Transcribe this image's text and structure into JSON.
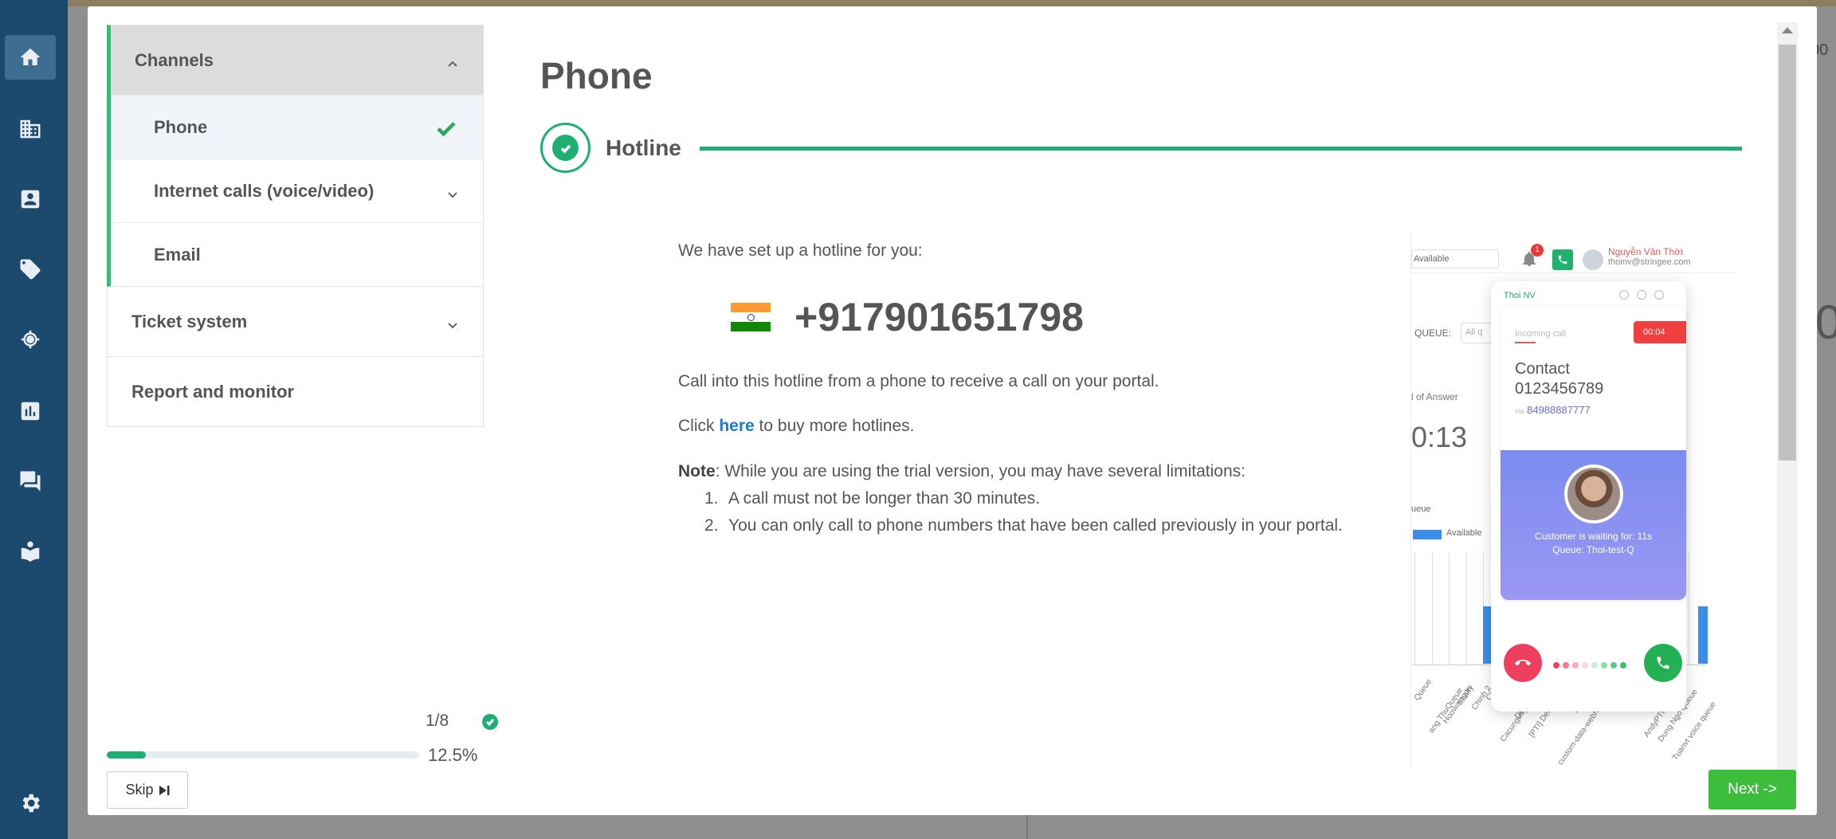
{
  "background": {
    "right_text_top": "00",
    "right_text_big": "0"
  },
  "leftnav": {
    "items": [
      "home-icon",
      "building-icon",
      "contact-card-icon",
      "tag-icon",
      "target-icon",
      "chart-icon",
      "chat-icon",
      "reader-icon"
    ],
    "bottom": "gear-icon"
  },
  "sidebar": {
    "sections": [
      {
        "label": "Channels",
        "expanded": true,
        "items": [
          {
            "label": "Phone",
            "current": true,
            "done": true
          },
          {
            "label": "Internet calls (voice/video)",
            "expandable": true
          },
          {
            "label": "Email"
          }
        ]
      },
      {
        "label": "Ticket system",
        "expandable": true
      },
      {
        "label": "Report and monitor"
      }
    ],
    "progress": {
      "step": "1/8",
      "percent_label": "12.5%",
      "fraction": 0.125
    },
    "skip_label": "Skip"
  },
  "main": {
    "title": "Phone",
    "step_label": "Hotline",
    "setup_text": "We have set up a hotline for you:",
    "hotline_number": "+917901651798",
    "call_text": "Call into this hotline from a phone to receive a call on your portal.",
    "click_prefix": "Click",
    "click_link": "here",
    "click_suffix": "to buy more hotlines.",
    "note_label": "Note",
    "note_text": ": While you are using the trial version, you may have several limitations:",
    "limits": [
      "A call must not be longer than 30 minutes.",
      "You can only call to phone numbers that have been called previously in your portal."
    ]
  },
  "illustration": {
    "status": "Available",
    "badge": "1",
    "user_name": "Nguyễn Văn Thời",
    "user_email": "thoinv@stringee.com",
    "queue_label": "QUEUE:",
    "queue_value": "All q",
    "answer_label": "l of Answer",
    "time": "0:13",
    "sueue_label": "ueue",
    "legend": "Available",
    "card_name": "Thoi NV",
    "incoming": "Incoming call",
    "timer": "00:04",
    "contact_line1": "Contact",
    "contact_line2": "0123456789",
    "via_prefix": "via",
    "via_number": "84988887777",
    "waiting": "Customer is waiting for: 11s",
    "queue_name": "Queue: Thoi-test-Q",
    "x_labels": [
      "Queue",
      "ang ThuQueue",
      "Hoowaingon",
      "Sbalty",
      "Chinh 2",
      "Chinh",
      "Cacunguo_queue",
      "Duoc Test",
      "[PTI] Default",
      "duongts",
      "custom-data-webhook-get-list-agents",
      "Thang LV",
      "0101",
      "Sicol",
      "Sang",
      "Son",
      "AndyPTM Queue",
      "Dung Ngo Queue",
      "Tuanvt voice queue"
    ]
  },
  "next_label": "Next ->",
  "colors": {
    "nav_bg": "#1c4a6e",
    "accent_green": "#1faf73",
    "link_blue": "#1c79d4",
    "next_green": "#3cbd3c"
  }
}
